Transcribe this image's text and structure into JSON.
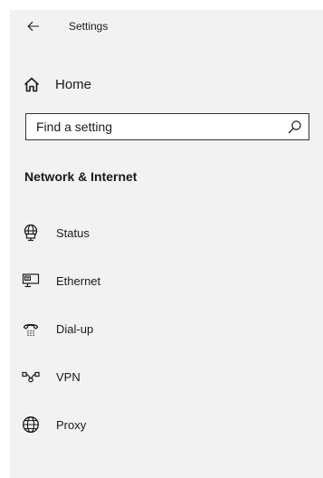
{
  "window": {
    "title": "Settings"
  },
  "home": {
    "label": "Home",
    "icon": "home-icon"
  },
  "search": {
    "placeholder": "Find a setting",
    "value": "",
    "icon": "search-icon"
  },
  "section": {
    "heading": "Network & Internet"
  },
  "nav": {
    "items": [
      {
        "label": "Status",
        "icon": "globe-monitor-icon"
      },
      {
        "label": "Ethernet",
        "icon": "ethernet-icon"
      },
      {
        "label": "Dial-up",
        "icon": "dialup-phone-icon"
      },
      {
        "label": "VPN",
        "icon": "vpn-icon"
      },
      {
        "label": "Proxy",
        "icon": "globe-icon"
      }
    ]
  },
  "colors": {
    "pane_background": "#f2f2f2",
    "text": "#1a1a1a",
    "search_border": "#333333"
  }
}
